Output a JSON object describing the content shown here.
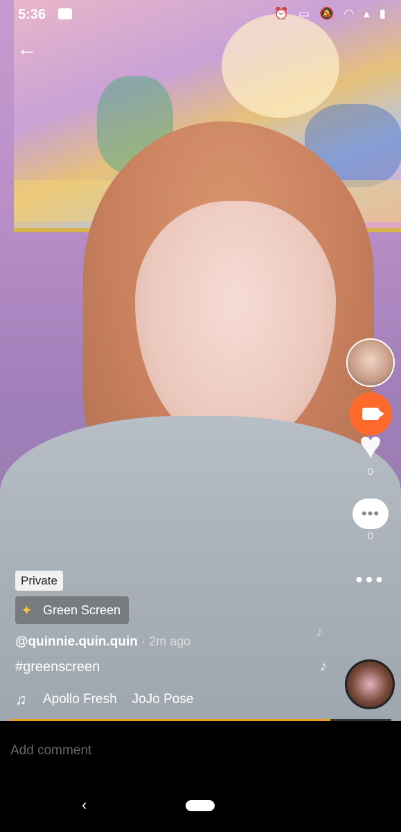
{
  "status_bar": {
    "time": "5:36",
    "icons": [
      "screen-record-icon",
      "alarm-icon",
      "cast-icon",
      "mute-icon",
      "wifi-icon",
      "signal-icon",
      "battery-icon"
    ]
  },
  "video": {
    "private_label": "Private",
    "effect_label": "Green Screen",
    "author": "@quinnie.quin.quin",
    "time_ago": "· 2m ago",
    "hashtag": "#greenscreen",
    "music": {
      "title": "Apollo Fresh",
      "title2": "JoJo Pose"
    },
    "likes": "0",
    "comments": "0",
    "progress": 0.84
  },
  "comment": {
    "placeholder": "Add comment"
  },
  "colors": {
    "live_button": "#fe6a2c",
    "progress": "#f0a020"
  }
}
